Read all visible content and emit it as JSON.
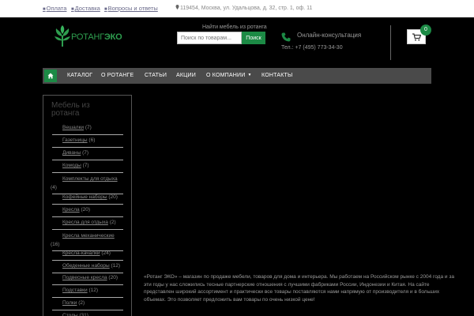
{
  "topbar": {
    "links": [
      "Оплата",
      "Доставка",
      "Вопросы и ответы"
    ],
    "address": "119454, Москва, ул. Удальцова, д. 32, стр. 1, оф. 11"
  },
  "logo": {
    "part1": "РОТАНГ",
    "part2": "ЭКО"
  },
  "search": {
    "label": "Найти мебель из ротанга",
    "placeholder": "Поиск по товарам...",
    "button": "Поиск"
  },
  "consultation": {
    "label": "Онлайн-консультация",
    "phone": "Тел.: +7 (495) 773-34-30"
  },
  "cart": {
    "count": "0"
  },
  "nav": {
    "items": [
      "КАТАЛОГ",
      "О РОТАНГЕ",
      "СТАТЬИ",
      "АКЦИИ",
      "О КОМПАНИИ",
      "КОНТАКТЫ"
    ]
  },
  "sidebar": {
    "title": "Мебель из ротанга",
    "categories": [
      {
        "name": "Вешалки",
        "count": "(7)"
      },
      {
        "name": "Газетницы",
        "count": "(6)"
      },
      {
        "name": "Диваны",
        "count": "(7)"
      },
      {
        "name": "Комоды",
        "count": "(7)"
      },
      {
        "name": "Комплекты для отдыха",
        "count": "(4)"
      },
      {
        "name": "Кофейные наборы",
        "count": "(20)"
      },
      {
        "name": "Кресла",
        "count": "(20)"
      },
      {
        "name": "Кресла для отдыха",
        "count": "(2)"
      },
      {
        "name": "Кресла механические",
        "count": "(16)"
      },
      {
        "name": "Кресла-качалки",
        "count": "(24)"
      },
      {
        "name": "Обеденные наборы",
        "count": "(12)"
      },
      {
        "name": "Подвесные кресла",
        "count": "(20)"
      },
      {
        "name": "Подставки",
        "count": "(12)"
      },
      {
        "name": "Полки",
        "count": "(2)"
      },
      {
        "name": "Столы",
        "count": "(31)"
      }
    ]
  },
  "description": "«Ротанг ЭКО» – магазин по продаже мебели, товаров для дома и интерьера. Мы работаем на Российском рынке с 2004 года и за эти годы у нас сложились тесные партнерские отношения с лучшими фабриками России, Индонезии и Китая. На сайте представлен широкий ассортимент и практически все товары поставляются нами напрямую от производителя и в больших объемах. Это позволяет предложить вам товары по очень низкой цене!",
  "colors": {
    "brand": "#1c8a45",
    "nav": "#4a4a4a"
  }
}
